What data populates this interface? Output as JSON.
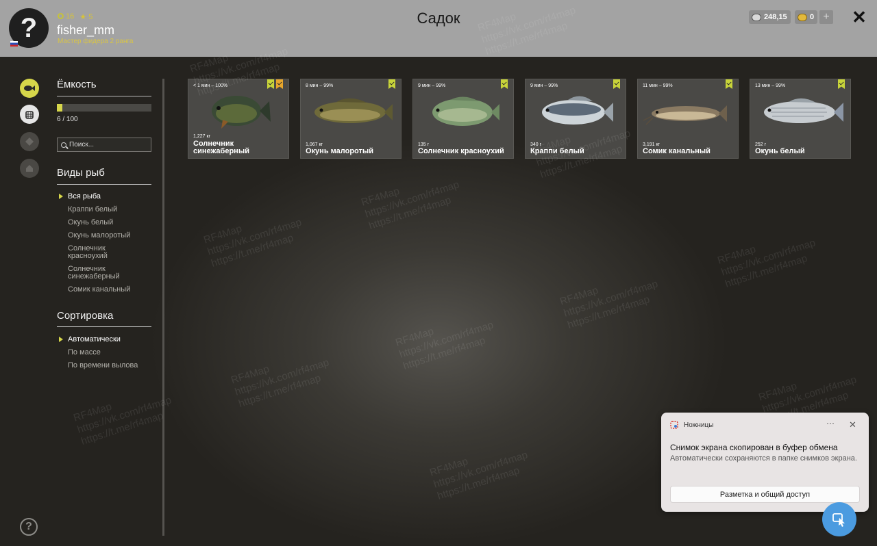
{
  "header": {
    "avatar_glyph": "?",
    "stat_level": "16",
    "stat_stars": "5",
    "username": "fisher_mm",
    "rank": "Мастер фидера 2 ранга",
    "title": "Садок",
    "silver": "248,15",
    "gold": "0",
    "add_glyph": "+",
    "close_glyph": "✕"
  },
  "sidebar": {
    "capacity_title": "Ёмкость",
    "capacity_level": 0.06,
    "capacity_text": "6 / 100",
    "search_placeholder": "Поиск...",
    "species_title": "Виды рыб",
    "species": [
      "Вся рыба",
      "Краппи белый",
      "Окунь белый",
      "Окунь малоротый",
      "Солнечник красноухий",
      "Солнечник синежаберный",
      "Сомик канальный"
    ],
    "sort_title": "Сортировка",
    "sort_options": [
      "Автоматически",
      "По массе",
      "По времени вылова"
    ],
    "help_glyph": "?"
  },
  "fish": [
    {
      "time": "< 1 мин – 100%",
      "weight": "1,227 кг",
      "name": "Солнечник синежаберный"
    },
    {
      "time": "8 мин – 99%",
      "weight": "1,067 кг",
      "name": "Окунь малоротый"
    },
    {
      "time": "9 мин – 99%",
      "weight": "135 г",
      "name": "Солнечник красноухий"
    },
    {
      "time": "9 мин – 99%",
      "weight": "340 г",
      "name": "Краппи белый"
    },
    {
      "time": "11 мин – 99%",
      "weight": "3,191 кг",
      "name": "Сомик канальный"
    },
    {
      "time": "13 мин – 99%",
      "weight": "252 г",
      "name": "Окунь белый"
    }
  ],
  "toast": {
    "app": "Ножницы",
    "more": "···",
    "close": "✕",
    "title": "Снимок экрана скопирован в буфер обмена",
    "body": "Автоматически сохраняются в папке снимков экрана.",
    "button": "Разметка и общий доступ"
  },
  "watermark": {
    "brand": "RF4Map",
    "vk": "https://vk.com/rf4map",
    "tg": "https://t.me/rf4map"
  },
  "colors": {
    "accent": "#d6d64a",
    "badge": "#c8d43a",
    "badge_new": "#e8a62c"
  }
}
